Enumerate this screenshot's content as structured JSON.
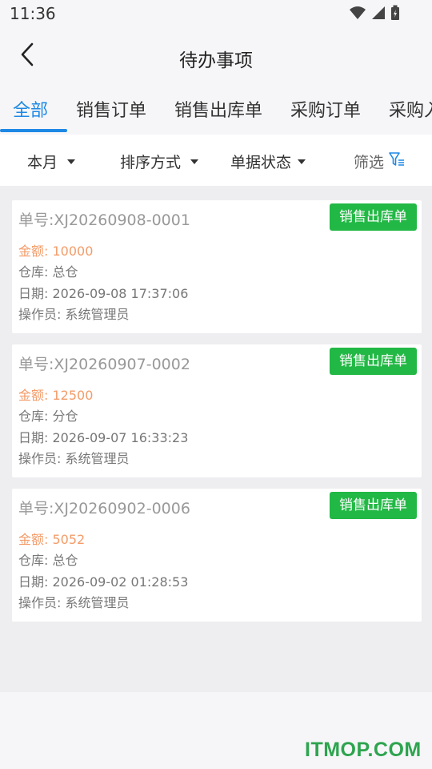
{
  "status_bar": {
    "time": "11:36",
    "icons": [
      "wifi-icon",
      "signal-icon",
      "battery-icon"
    ]
  },
  "header": {
    "title": "待办事项",
    "back_icon": "chevron-left-icon"
  },
  "tabs": [
    {
      "label": "全部",
      "active": true
    },
    {
      "label": "销售订单",
      "active": false
    },
    {
      "label": "销售出库单",
      "active": false
    },
    {
      "label": "采购订单",
      "active": false
    },
    {
      "label": "采购入",
      "active": false
    }
  ],
  "filters": {
    "month": "本月",
    "sort": "排序方式",
    "status": "单据状态",
    "screen": "筛选",
    "screen_icon": "filter-icon"
  },
  "cards": [
    {
      "no": "单号:XJ20260908-0001",
      "badge": "销售出库单",
      "amount": "金额: 10000",
      "warehouse": "仓库: 总仓",
      "date": "日期: 2026-09-08 17:37:06",
      "operator": "操作员: 系统管理员"
    },
    {
      "no": "单号:XJ20260907-0002",
      "badge": "销售出库单",
      "amount": "金额: 12500",
      "warehouse": "仓库: 分仓",
      "date": "日期: 2026-09-07 16:33:23",
      "operator": "操作员: 系统管理员"
    },
    {
      "no": "单号:XJ20260902-0006",
      "badge": "销售出库单",
      "amount": "金额: 5052",
      "warehouse": "仓库: 总仓",
      "date": "日期: 2026-09-02 01:28:53",
      "operator": "操作员: 系统管理员"
    }
  ],
  "colors": {
    "accent": "#1e88e5",
    "badge": "#22b845",
    "amount": "#f39c69"
  },
  "watermark": "ITMOP.COM"
}
